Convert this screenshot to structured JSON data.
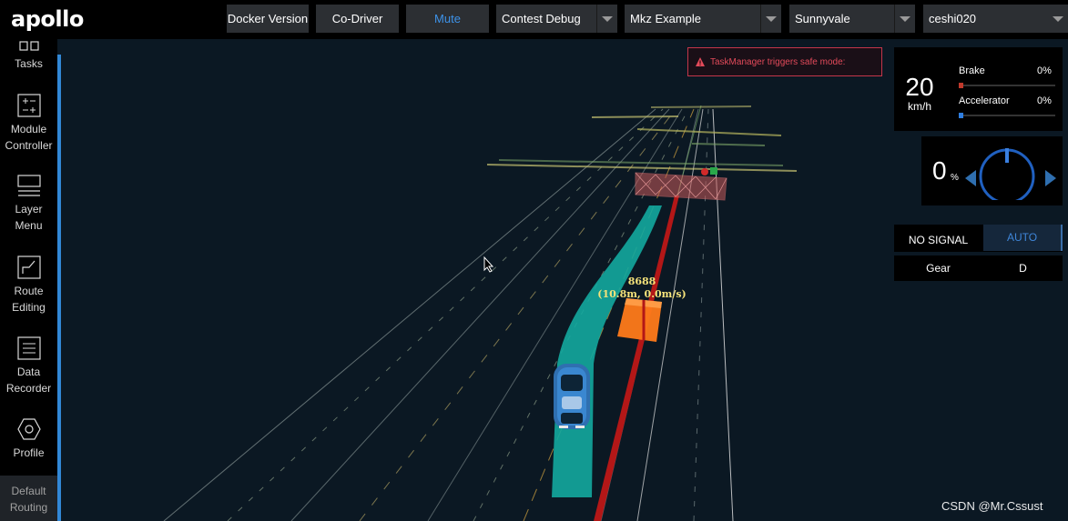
{
  "header": {
    "logo": "apollo",
    "buttons": {
      "docker_version": "Docker Version",
      "co_driver": "Co-Driver",
      "mute": "Mute"
    },
    "selects": {
      "mode": "Contest Debug",
      "vehicle": "Mkz Example",
      "map": "Sunnyvale",
      "scenario": "ceshi020"
    }
  },
  "sidebar": {
    "items": [
      {
        "label_1": "Tasks",
        "label_2": ""
      },
      {
        "label_1": "Module",
        "label_2": "Controller"
      },
      {
        "label_1": "Layer",
        "label_2": "Menu"
      },
      {
        "label_1": "Route",
        "label_2": "Editing"
      },
      {
        "label_1": "Data",
        "label_2": "Recorder"
      },
      {
        "label_1": "Profile",
        "label_2": ""
      }
    ],
    "default_routing": {
      "label_1": "Default",
      "label_2": "Routing"
    }
  },
  "alert": {
    "text": "TaskManager triggers safe mode:",
    "color": "#e24a5a"
  },
  "dashboard": {
    "speed": "20",
    "speed_unit": "km/h",
    "brake_label": "Brake",
    "brake_pct": "0%",
    "brake_level": 0,
    "accelerator_label": "Accelerator",
    "accelerator_pct": "0%",
    "accelerator_level": 0,
    "steering": "0",
    "steering_unit": "%",
    "signal": "NO SIGNAL",
    "driving_mode": "AUTO",
    "gear_label": "Gear",
    "gear_value": "D"
  },
  "scene": {
    "obstacle_id": "8688",
    "obstacle_info": "(10.8m, 0.0m/s)"
  },
  "watermark": "CSDN @Mr.Cssust",
  "colors": {
    "accent": "#3288d6",
    "brake": "#c0392b",
    "accelerator": "#2f7ee0",
    "path": "#13a89e",
    "obstacle": "#ff7a1a",
    "reference_line": "#b31717"
  }
}
